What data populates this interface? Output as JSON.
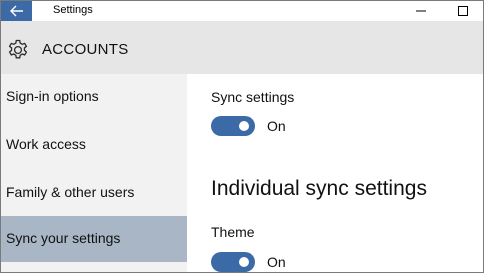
{
  "titlebar": {
    "title": "Settings",
    "back_icon": "back-arrow-icon",
    "minimize_icon": "minimize-icon",
    "maximize_icon": "maximize-icon",
    "accent": "#3c6aa6"
  },
  "header": {
    "icon": "gear-icon",
    "title": "ACCOUNTS"
  },
  "sidebar": {
    "items": [
      {
        "label": "Sign-in options",
        "selected": false
      },
      {
        "label": "Work access",
        "selected": false
      },
      {
        "label": "Family & other users",
        "selected": false
      },
      {
        "label": "Sync your settings",
        "selected": true
      }
    ],
    "selected_color": "#a9b6c6"
  },
  "main": {
    "sync_label": "Sync settings",
    "sync_state": "On",
    "section_title": "Individual sync settings",
    "theme_label": "Theme",
    "theme_state": "On"
  }
}
